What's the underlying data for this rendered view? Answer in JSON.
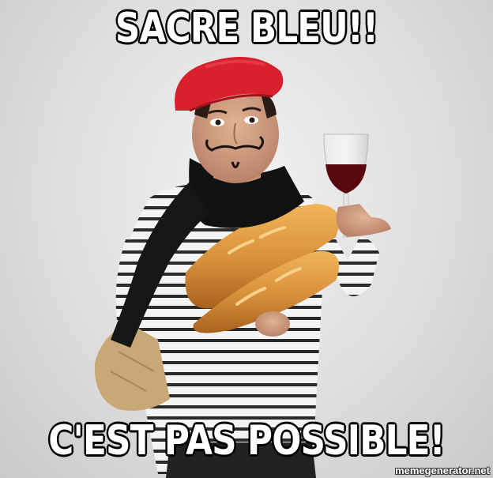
{
  "meme": {
    "top_text": "SACRE BLEU!!",
    "bottom_text": "C'EST PAS POSSIBLE!",
    "watermark": "memegenerator.net"
  },
  "colors": {
    "caption_fill": "#ffffff",
    "caption_stroke": "#000000",
    "beret": "#d8202e",
    "wine": "#5a0810",
    "bread": "#d88f3a",
    "scarf": "#111111"
  }
}
